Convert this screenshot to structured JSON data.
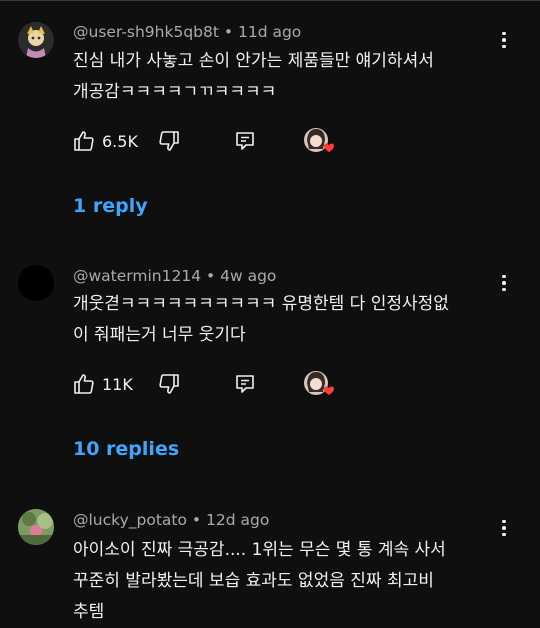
{
  "colors": {
    "background": "#0f0f0f",
    "text": "#f1f1f1",
    "meta": "#aaaaaa",
    "link": "#3ea6ff",
    "heart": "#ff3b3b"
  },
  "comments": [
    {
      "author": "@user-sh9hk5qb8t",
      "age": "11d ago",
      "text_lines": [
        "진심 내가 사놓고 손이 안가는 제품들만 얘기하셔서",
        "개공감ㅋㅋㅋㅋㄱㄲㅋㅋㅋㅋ"
      ],
      "likes": "6.5K",
      "replies_label": "1 reply",
      "avatar_icon": "anime-character-avatar"
    },
    {
      "author": "@watermin1214",
      "age": "4w ago",
      "text_lines": [
        "개웃겯ㅋㅋㅋㅋㅋㅋㅋㅋㅋㅋ 유명한템 다 인정사정없",
        "이 줘패는거 너무 웃기다"
      ],
      "likes": "11K",
      "replies_label": "10 replies",
      "avatar_icon": "black-circle-avatar"
    },
    {
      "author": "@lucky_potato",
      "age": "12d ago",
      "text_lines": [
        "아이소이 진짜 극공감.... 1위는 무슨 몇 통 계속 사서",
        "꾸준히 발라봤는데 보습 효과도 없었음 진짜 최고비",
        "추템"
      ],
      "avatar_icon": "green-photo-avatar"
    }
  ],
  "separator": "•"
}
